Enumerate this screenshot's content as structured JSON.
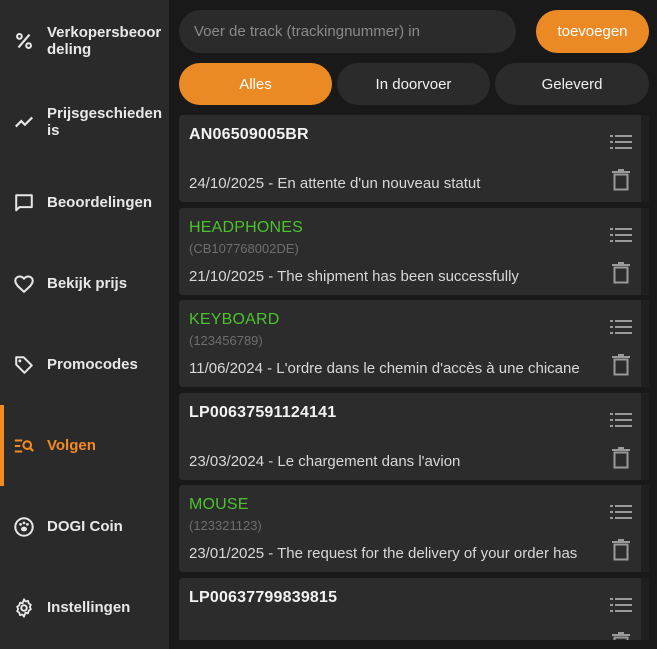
{
  "sidebar": {
    "items": [
      {
        "label": "Verkopersbeoordeling",
        "icon": "percent-icon",
        "active": false
      },
      {
        "label": "Prijsgeschiedenis",
        "icon": "trend-line-icon",
        "active": false
      },
      {
        "label": "Beoordelingen",
        "icon": "chat-bubble-icon",
        "active": false
      },
      {
        "label": "Bekijk prijs",
        "icon": "heart-icon",
        "active": false
      },
      {
        "label": "Promocodes",
        "icon": "tag-icon",
        "active": false
      },
      {
        "label": "Volgen",
        "icon": "track-search-icon",
        "active": true
      },
      {
        "label": "DOGI Coin",
        "icon": "paw-icon",
        "active": false
      },
      {
        "label": "Instellingen",
        "icon": "gear-icon",
        "active": false
      }
    ]
  },
  "search": {
    "placeholder": "Voer de track (trackingnummer) in",
    "value": ""
  },
  "add_button": {
    "label": "toevoegen"
  },
  "filters": [
    {
      "label": "Alles",
      "active": true
    },
    {
      "label": "In doorvoer",
      "active": false
    },
    {
      "label": "Geleverd",
      "active": false
    }
  ],
  "shipments": [
    {
      "title": "AN06509005BR",
      "code": "",
      "status": "24/10/2025 - En attente d'un nouveau statut"
    },
    {
      "title": "HEADPHONES",
      "code": "(CB107768002DE)",
      "status": "21/10/2025 - The shipment has been successfully"
    },
    {
      "title": "KEYBOARD",
      "code": "(123456789)",
      "status": "11/06/2024 - L'ordre dans le chemin d'accès à une chicane"
    },
    {
      "title": "LP00637591124141",
      "code": "",
      "status": "23/03/2024 - Le chargement dans l'avion"
    },
    {
      "title": "MOUSE",
      "code": "(123321123)",
      "status": "23/01/2025 - The request for the delivery of your order has"
    },
    {
      "title": "LP00637799839815",
      "code": "",
      "status": ""
    }
  ],
  "colors": {
    "accent": "#eb8a24",
    "named_title": "#4cc22d",
    "sidebar_bg": "#2a2a2a",
    "card_bg": "#2c2c2c"
  }
}
